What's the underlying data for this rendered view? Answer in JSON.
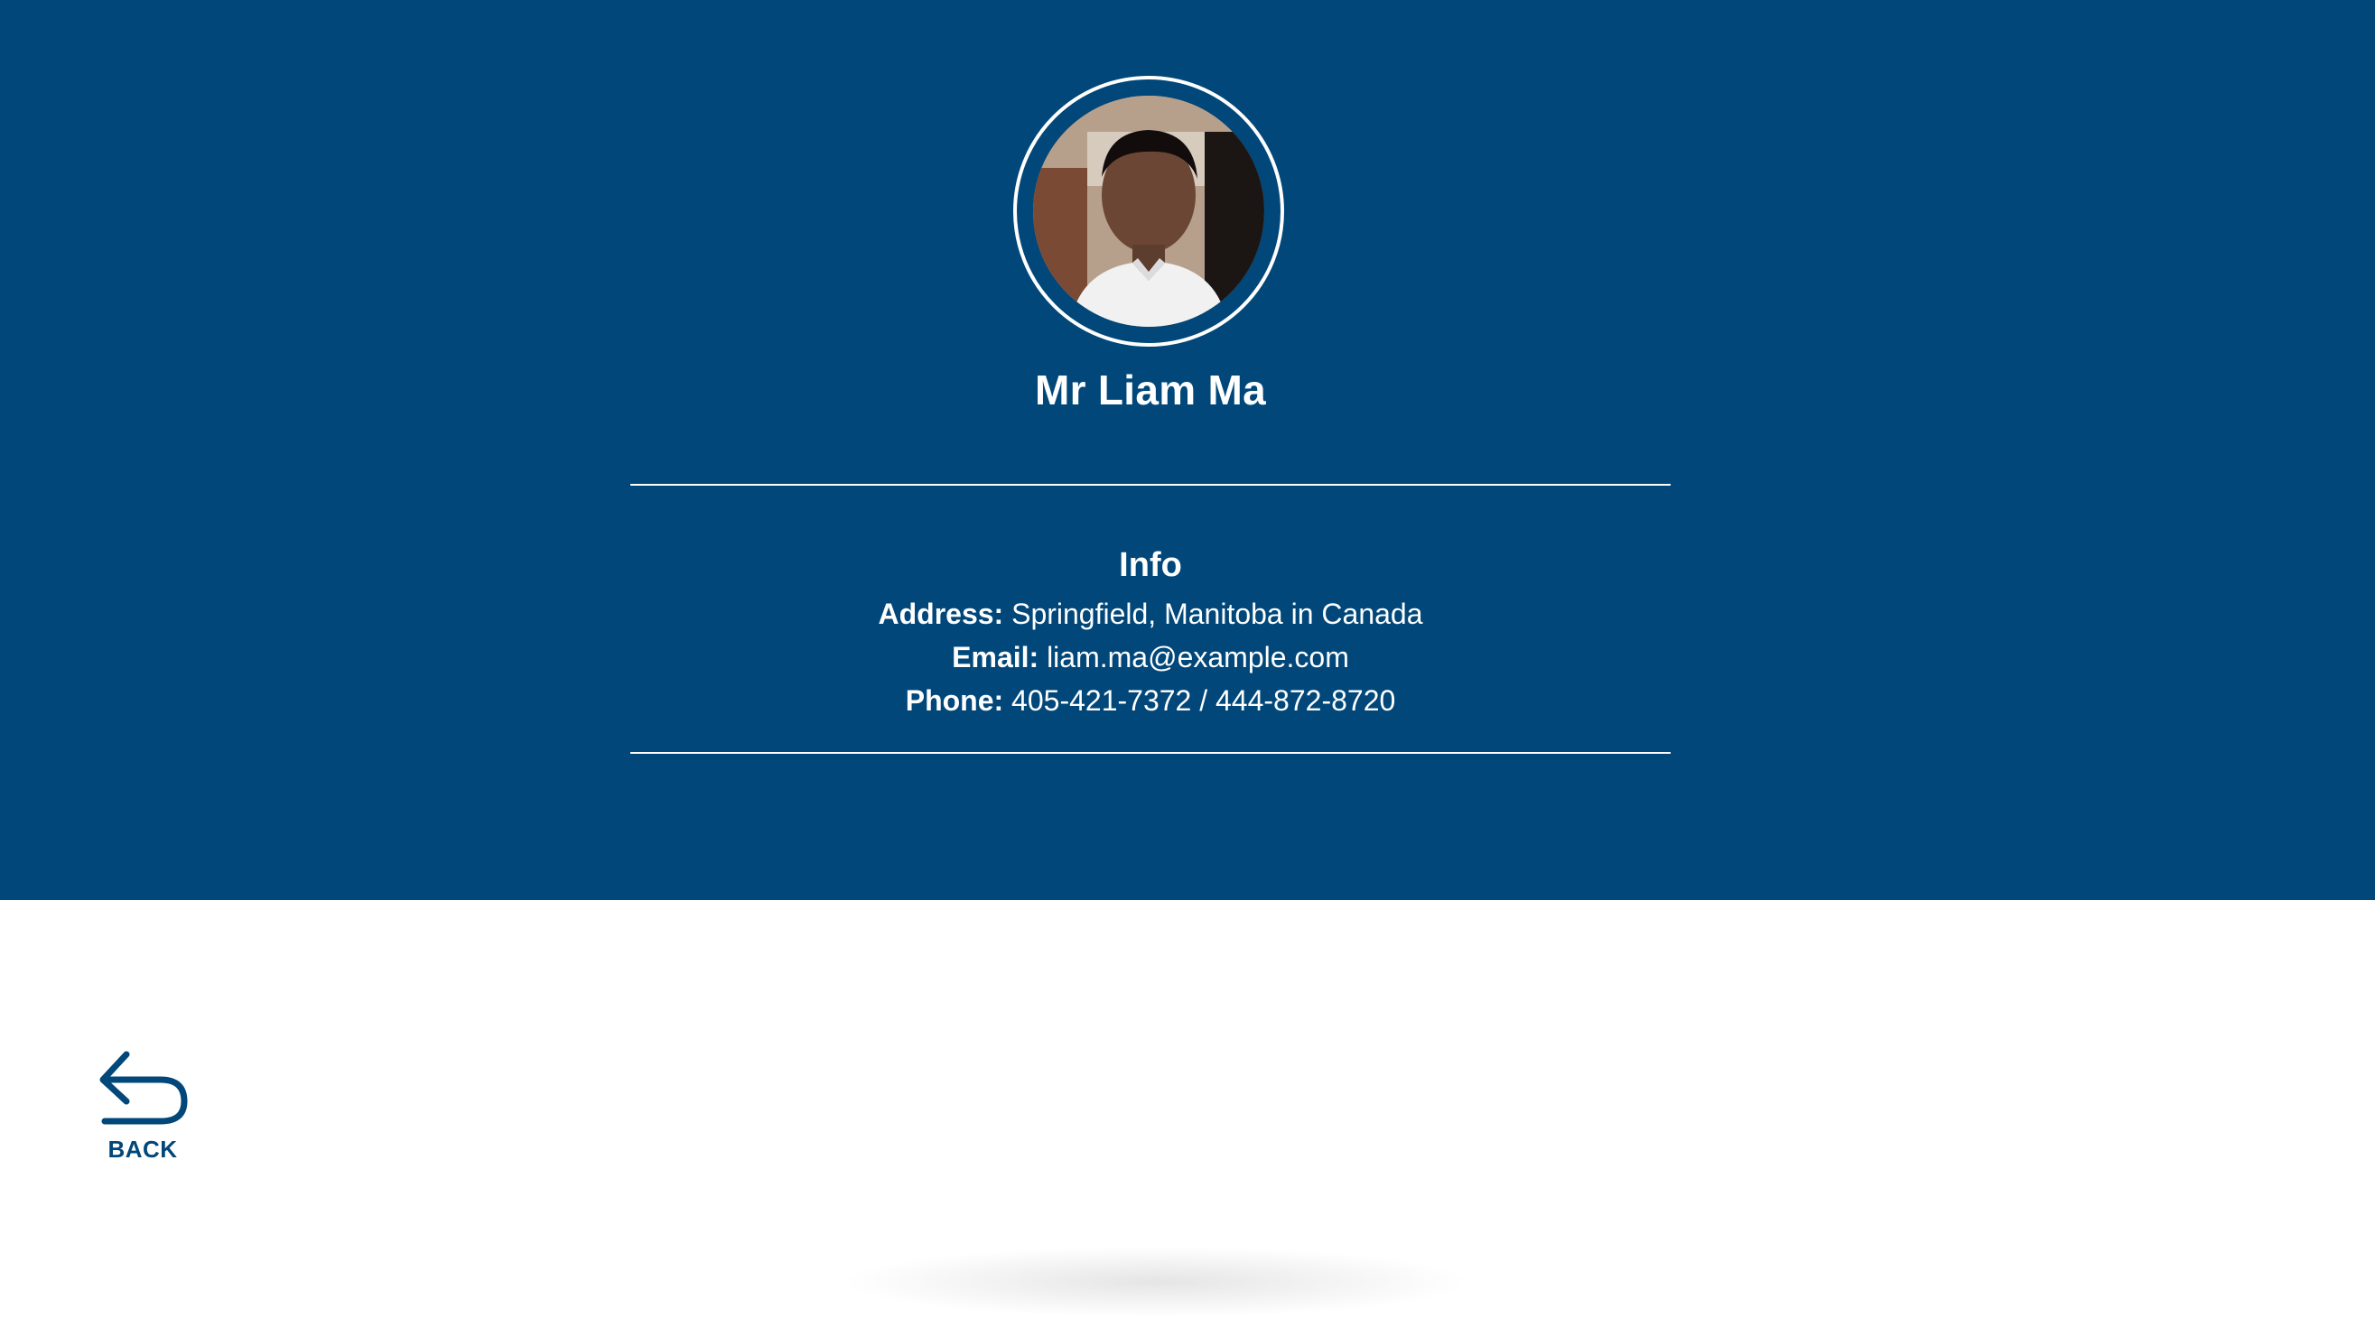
{
  "profile": {
    "name": "Mr Liam Ma",
    "avatar_alt": "Profile photo"
  },
  "info": {
    "title": "Info",
    "address_label": "Address:",
    "address_value": "Springfield, Manitoba in Canada",
    "email_label": "Email:",
    "email_value": "liam.ma@example.com",
    "phone_label": "Phone:",
    "phone_value": "405-421-7372 / 444-872-8720"
  },
  "nav": {
    "back_label": "BACK",
    "back_icon": "undo-arrow-icon"
  },
  "colors": {
    "hero_background": "#014779",
    "text_on_hero": "#ffffff",
    "accent": "#014779"
  }
}
